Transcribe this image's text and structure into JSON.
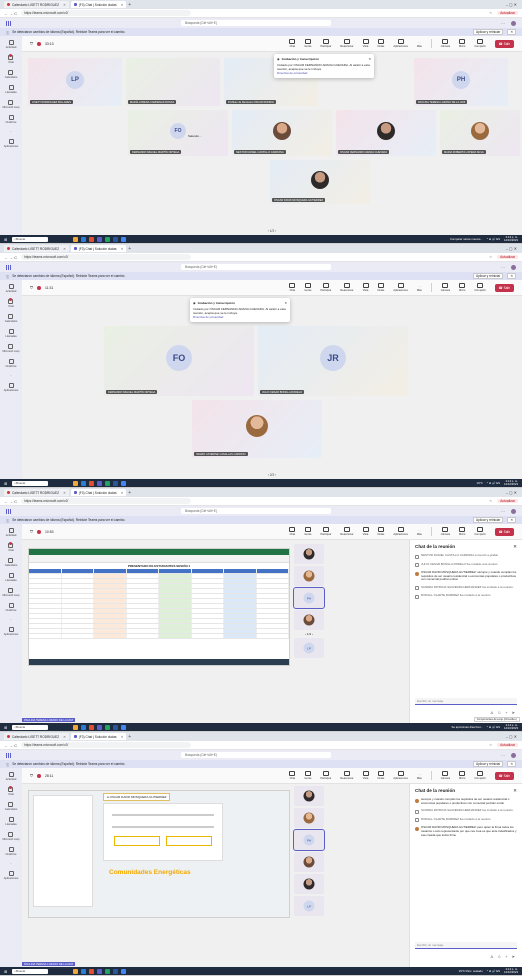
{
  "browser": {
    "tab1": "Calendario LISETT RODRIGUEZ",
    "tab2": "(F3) Chat | Solución dudas",
    "tab2_alt": "(F3) Chat | Solución dudas",
    "url": "https://teams.microsoft.com/v2/",
    "update_label": "Actualizar",
    "nav": "← → C",
    "win": "–  ◻  ✕"
  },
  "teams": {
    "search_placeholder": "Búsqueda (Ctrl+Alt+E)",
    "more": "···",
    "notice": "Se detectaron cambios de idioma (Español). Reinicie Teams para ver el cambio.",
    "notice_btn1": "Aplicar y reiniciar",
    "notice_btn2": "✕"
  },
  "rail": [
    {
      "label": "Actividad"
    },
    {
      "label": "Chat"
    },
    {
      "label": "Calendario"
    },
    {
      "label": "Llamadas"
    },
    {
      "label": "Microsoft Loop"
    },
    {
      "label": "OneDrive"
    },
    {
      "label": "···"
    },
    {
      "label": "Aplicaciones"
    }
  ],
  "controls": {
    "chat": "Chat",
    "people": "Gente",
    "raise": "Participar",
    "react": "Reaccionar",
    "view": "Vista",
    "notes": "Notas",
    "apps": "Aplicaciones",
    "more": "Más",
    "camera": "Cámara",
    "mic": "Micro",
    "share": "Compartir",
    "leave": "Salir"
  },
  "screen1": {
    "time": "33:13",
    "popup_title": "Grabación y transcripción",
    "popup_text": "Invitado por OSCAR FERNANDO ARANA GUEVARA. Al asistir a esta reunión, acepta que se le incluya.",
    "popup_link": "Directiva de privacidad",
    "tiles": [
      {
        "initials": "LP",
        "name": "LISETT RODRIGUEZ PALLARES"
      },
      {
        "initials": "",
        "name": "MARÍA LORENA CARDENAS ROSAS"
      },
      {
        "initials": "",
        "name": "Proffeso de Reniones OSCAR RODRIG"
      },
      {
        "initials": "PH",
        "name": "PAULINA TERESA LOZANO DE LA HOZ"
      },
      {
        "initials": "FO",
        "name": "FERNANDO MIGUEL MARTÍN ORTEGA",
        "extra": "Salendo..."
      },
      {
        "initials": "",
        "name": "NESTOR DANIEL CASTILLO CARDONA"
      },
      {
        "initials": "",
        "name": "OSCAR FERNANDO ARANA GUEVARA"
      },
      {
        "initials": "",
        "name": "MARIA ROBERTA LOPERA SILVA"
      },
      {
        "initials": "",
        "name": "OSCAR DAVID MOSQUERA GUTIERREZ"
      }
    ],
    "pager": "‹  1/2  ›"
  },
  "screen2": {
    "time": "11:31",
    "tiles": [
      {
        "initials": "FO",
        "name": "FERNANDO MIGUEL MARTÍN ORTEGA"
      },
      {
        "initials": "JR",
        "name": "JULIO CESAR BONILLA RODELO"
      },
      {
        "initials": "",
        "name": "INGRID CATERINE CASALLAS CARRION"
      }
    ],
    "pager": "‹  2/2  ›"
  },
  "screen3": {
    "time": "10:53",
    "sheet_title": "PRESENTADO DE ESTUDIANTES SESIÓN 1",
    "pager": "‹  1/4  ›",
    "self_initials": "LP",
    "tooltip": "Componentes de Loop (Ctrl+Alt+L)",
    "presenter": "PAULINA TERESA LOZANO DE LA HOZ",
    "taskbar_notice": "Se aproximan días lluvi...",
    "chat_title": "Chat de la reunión",
    "chat": [
      {
        "kind": "sys",
        "text": "NESTOR DANIEL CASTILLO CARDONA comenzó a grabar"
      },
      {
        "kind": "sys",
        "text": "JULIO CESAR BONILLA RODELO fue invitado a la reunión."
      },
      {
        "kind": "user",
        "text": "OSCAR DAVID MOSQUERA GUTIERREZ: siempre y cuando cumplan los requisitos de ser usuario residencial o economías populares o productivos con comercial podrían entrar"
      },
      {
        "kind": "sys",
        "text": "SANDRA PATRICIA SAAVEDRA HERNANDEZ fue invitado a la reunión."
      },
      {
        "kind": "sys",
        "text": "ROIFALL OLARTE RAMIREZ fue invitado a la reunión."
      }
    ],
    "input_placeholder": "Escribir un mensaje"
  },
  "screen4": {
    "time": "28:11",
    "doc_title": "Comunidades Energéticas",
    "presenting": "OSCAR DAVID MOSQUERA GUTIERREZ",
    "presenter": "PAULINA TERESA LOZANO DE LA HOZ",
    "taskbar_weather": "19°C  Parc. soleado",
    "chat_title": "Chat de la reunión",
    "chat": [
      {
        "kind": "user",
        "text": "siempre y cuando cumplan los requisitos de ser usuario residencial o economías populares o productivos con comercial podrían entrar"
      },
      {
        "kind": "sys",
        "text": "SANDRA PATRICIA SAAVEDRA HERNANDEZ fue invitado a la reunión."
      },
      {
        "kind": "sys",
        "text": "ROIFALL OLARTE RAMIREZ fue invitado a la reunión."
      },
      {
        "kind": "user",
        "text": "OSCAR DAVID MOSQUERA GUTIERREZ: pero quien la firma todos los usuarios o solo representante por que ces crea es que ante indetificados y esa creada que todos firme"
      }
    ],
    "input_placeholder": "Escribir un mensaje",
    "self_initials": "LP"
  },
  "taskbar": {
    "search": "Buscar",
    "weather": "19°C",
    "notice": "Comparar varios nuevos...",
    "time": "2:14 p. m.",
    "date": "14/10/2023",
    "tray": "^  ⊕  🔊  ES"
  },
  "colors": {
    "accent": "#5b5fc7",
    "leave": "#c4314b",
    "taskbar": "#1f2b3e"
  }
}
